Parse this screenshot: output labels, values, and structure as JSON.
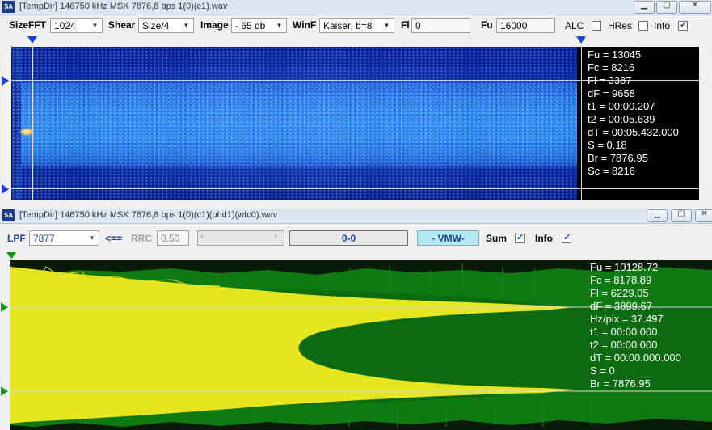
{
  "window1": {
    "title": "[TempDir] 146750 kHz MSK 7876,8 bps 1(0)(c1).wav",
    "toolbar": {
      "size_fft_label": "SizeFFT",
      "size_fft_value": "1024",
      "shear_label": "Shear",
      "shear_value": "Size/4",
      "image_label": "Image",
      "image_value": "- 65 db",
      "winf_label": "WinF",
      "winf_value": "Kaiser, b=8",
      "fl_label": "Fl",
      "fl_value": "0",
      "fu_label": "Fu",
      "fu_value": "16000",
      "alc_label": "ALC",
      "alc_checked": false,
      "hres_label": "HRes",
      "hres_checked": false,
      "info_label": "Info",
      "info_checked": true
    },
    "info": [
      "Fu = 13045",
      "Fc = 8216",
      "Fl = 3387",
      "dF = 9658",
      "t1 = 00:00.207",
      "t2 = 00:05.639",
      "dT = 00:05.432.000",
      "S = 0.18",
      "Br = 7876.95",
      "Sc = 8216"
    ]
  },
  "window2": {
    "title": "[TempDir] 146750 kHz MSK 7876,8 bps 1(0)(c1)(phd1)(wfc0).wav",
    "toolbar": {
      "lpf_label": "LPF",
      "lpf_value": "7877",
      "back_label": "<==",
      "rrc_label": "RRC",
      "rrc_value": "0.50",
      "range_value": "0-0",
      "vmw_label": "- VMW-",
      "sum_label": "Sum",
      "sum_checked": true,
      "info_label": "Info",
      "info_checked": true
    },
    "info": [
      "Fu = 10128.72",
      "Fc = 8178.89",
      "Fl = 6229.05",
      "dF = 3899.67",
      "Hz/pix = 37.497",
      "t1 = 00:00.000",
      "t2 = 00:00.000",
      "dT = 00:00.000.000",
      "S = 0",
      "Br = 7876.95"
    ]
  },
  "colors": {
    "accent_blue": "#1f3f8f",
    "plot_yellow": "#e6e61e",
    "plot_green": "#0f6e14",
    "marker_green": "#1e8c1e",
    "marker_blue": "#1a3fd6"
  },
  "icons": {
    "app_icon": "sa-app-icon",
    "minimize": "minimize-icon",
    "maximize": "maximize-icon",
    "close": "close-icon"
  }
}
